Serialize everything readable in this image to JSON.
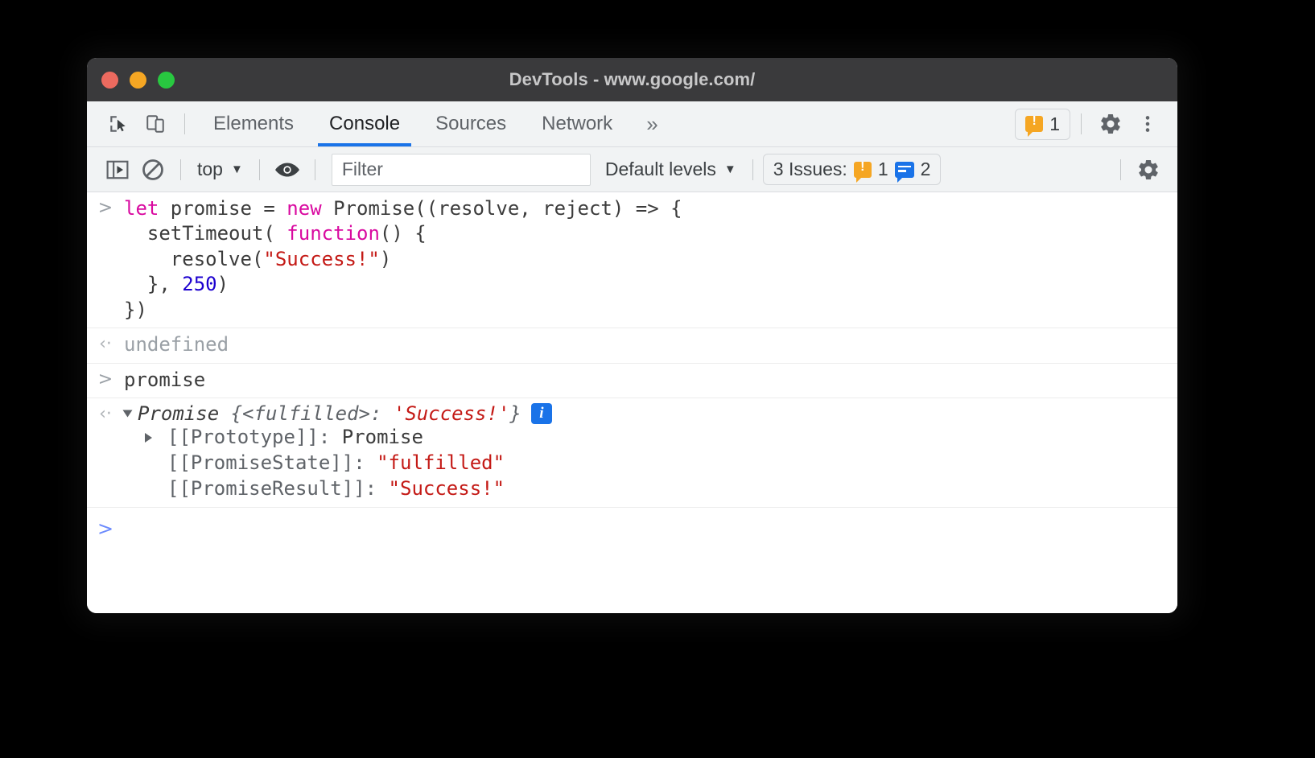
{
  "window": {
    "title": "DevTools - www.google.com/",
    "traffic_lights": [
      "close-button",
      "minimize-button",
      "maximize-button"
    ]
  },
  "tabbar": {
    "inspect_icon": "inspect-element-icon",
    "device_icon": "device-toolbar-icon",
    "tabs": [
      {
        "label": "Elements",
        "active": false
      },
      {
        "label": "Console",
        "active": true
      },
      {
        "label": "Sources",
        "active": false
      },
      {
        "label": "Network",
        "active": false
      }
    ],
    "more_tabs_label": "»",
    "warning_count": "1",
    "settings_icon": "gear-icon",
    "more_options_icon": "kebab-menu-icon"
  },
  "consolebar": {
    "sidebar_toggle_icon": "console-sidebar-icon",
    "clear_icon": "clear-console-icon",
    "context_label": "top",
    "eye_icon": "live-expressions-eye-icon",
    "filter_placeholder": "Filter",
    "filter_value": "",
    "levels_label": "Default levels",
    "issues_label": "3 Issues:",
    "issues_warning_count": "1",
    "issues_info_count": "2",
    "settings_icon": "console-settings-gear-icon"
  },
  "console": {
    "input_marker": ">",
    "output_marker": "‹·",
    "entries": [
      {
        "kind": "input",
        "code_lines": [
          [
            {
              "t": "let ",
              "c": "let"
            },
            {
              "t": "promise = ",
              "c": "plain"
            },
            {
              "t": "new ",
              "c": "new"
            },
            {
              "t": "Promise((resolve, reject) => {",
              "c": "plain"
            }
          ],
          [
            {
              "t": "  setTimeout( ",
              "c": "plain"
            },
            {
              "t": "function",
              "c": "fn"
            },
            {
              "t": "() {",
              "c": "plain"
            }
          ],
          [
            {
              "t": "    resolve(",
              "c": "plain"
            },
            {
              "t": "\"Success!\"",
              "c": "str"
            },
            {
              "t": ")",
              "c": "plain"
            }
          ],
          [
            {
              "t": "  }, ",
              "c": "plain"
            },
            {
              "t": "250",
              "c": "num"
            },
            {
              "t": ")",
              "c": "plain"
            }
          ],
          [
            {
              "t": "})",
              "c": "plain"
            }
          ]
        ]
      },
      {
        "kind": "result-undefined",
        "text": "undefined"
      },
      {
        "kind": "input",
        "code_lines": [
          [
            {
              "t": "promise",
              "c": "plain"
            }
          ]
        ]
      },
      {
        "kind": "result-object",
        "class_name": "Promise",
        "preview_prefix": " {<fulfilled>: ",
        "preview_value": "'Success!'",
        "preview_suffix": "}",
        "info_chip": "i",
        "properties": [
          {
            "expandable": true,
            "key": "[[Prototype]]: ",
            "value": "Promise",
            "value_kind": "plain"
          },
          {
            "expandable": false,
            "key": "[[PromiseState]]: ",
            "value": "\"fulfilled\"",
            "value_kind": "string"
          },
          {
            "expandable": false,
            "key": "[[PromiseResult]]: ",
            "value": "\"Success!\"",
            "value_kind": "string"
          }
        ]
      }
    ]
  },
  "colors": {
    "accent_blue": "#1a73e8",
    "warning_orange": "#f5a623",
    "string_red": "#c41a16",
    "keyword_magenta": "#d90aa0",
    "number_blue": "#1c00cf",
    "titlebar_bg": "#3a3a3c",
    "toolbar_bg": "#f1f3f4"
  }
}
